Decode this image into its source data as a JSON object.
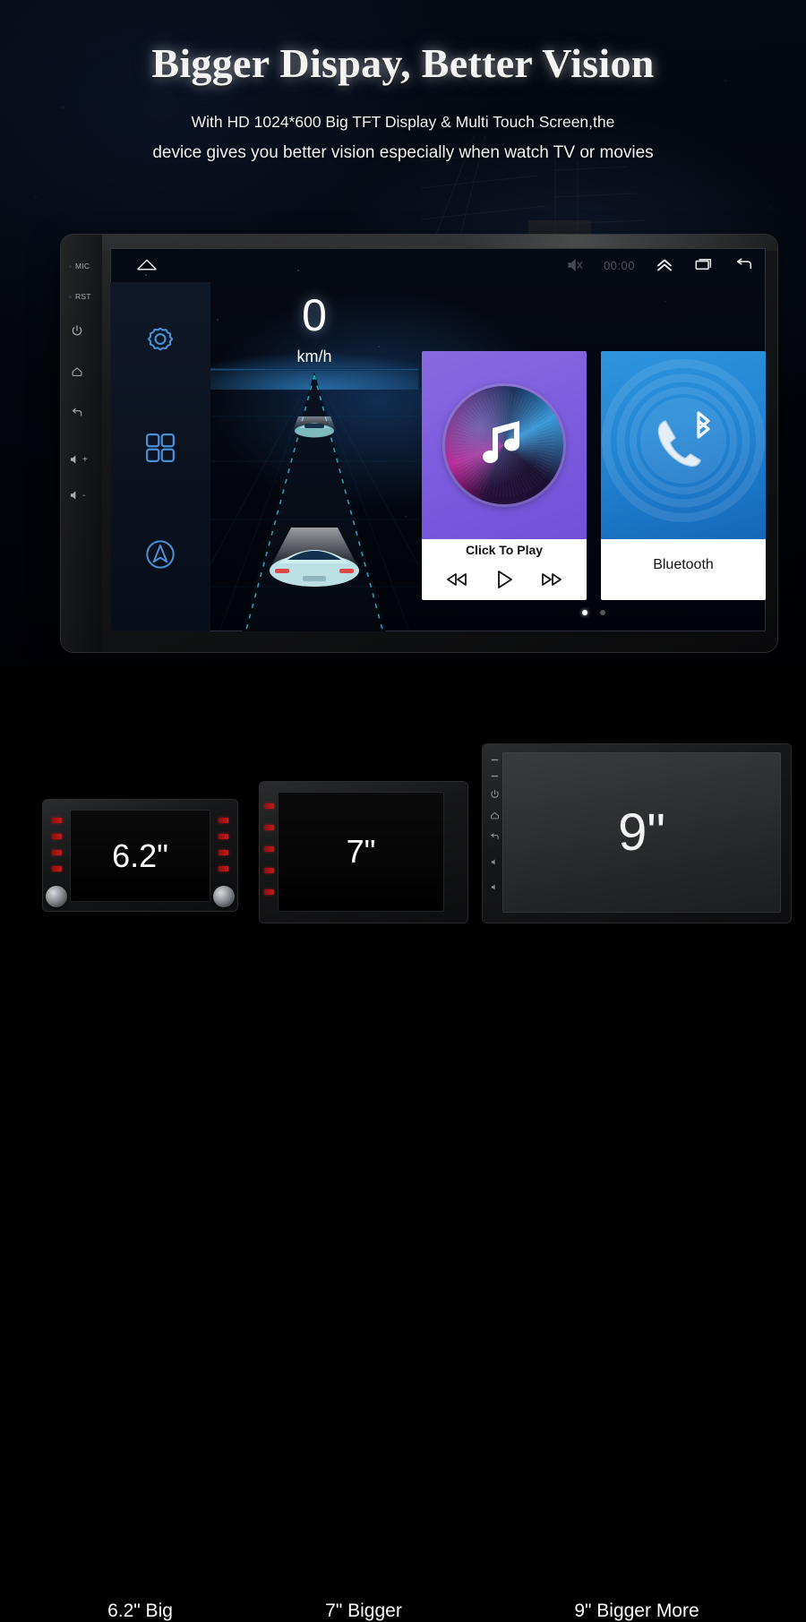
{
  "hero": {
    "title": "Bigger Dispay, Better Vision",
    "subtitle_line1": "With HD 1024*600 Big TFT Display & Multi Touch Screen,the",
    "subtitle_line2": "device gives you better vision especially when watch TV or movies"
  },
  "device": {
    "bezel_buttons": [
      {
        "label": "MIC",
        "icon": "mic-indicator-dot"
      },
      {
        "label": "RST",
        "icon": "reset-pinhole-dot"
      },
      {
        "label": "",
        "icon": "power-icon"
      },
      {
        "label": "",
        "icon": "home-icon"
      },
      {
        "label": "",
        "icon": "back-icon"
      },
      {
        "label": "+",
        "icon": "volume-up-icon"
      },
      {
        "label": "-",
        "icon": "volume-down-icon"
      }
    ],
    "statusbar": {
      "home_icon": "home-outline-icon",
      "mute_icon": "mute-icon",
      "clock": "00:00",
      "expand_icon": "chevron-double-up-icon",
      "recents_icon": "recents-icon",
      "back_icon": "back-arrow-icon"
    },
    "dock": [
      {
        "name": "settings",
        "icon": "gear-icon"
      },
      {
        "name": "apps",
        "icon": "apps-grid-icon"
      },
      {
        "name": "navigation",
        "icon": "navigation-arrow-icon"
      }
    ],
    "wallpaper": {
      "speed_value": "0",
      "speed_unit": "km/h"
    },
    "cards": [
      {
        "id": "music",
        "label": "Click To Play",
        "icon": "music-note-icon",
        "accent": "#7f5fe0",
        "controls": [
          {
            "name": "previous-track",
            "icon": "rewind-icon"
          },
          {
            "name": "play",
            "icon": "play-icon"
          },
          {
            "name": "next-track",
            "icon": "fast-forward-icon"
          }
        ]
      },
      {
        "id": "bluetooth",
        "label": "Bluetooth",
        "icon": "phone-bluetooth-icon",
        "accent": "#2387d6"
      }
    ],
    "page_dots": {
      "count": 2,
      "active_index": 0
    }
  },
  "compare": {
    "units": [
      {
        "size_text": "6.2\"",
        "caption": "6.2\" Big"
      },
      {
        "size_text": "7\"",
        "caption": "7\" Bigger"
      },
      {
        "size_text": "9\"",
        "caption": "9\" Bigger More"
      }
    ]
  },
  "colors": {
    "accent_blue": "#3d8fd6",
    "music_purple": "#7f5fe0",
    "bluetooth_blue": "#2387d6",
    "background": "#000000"
  }
}
